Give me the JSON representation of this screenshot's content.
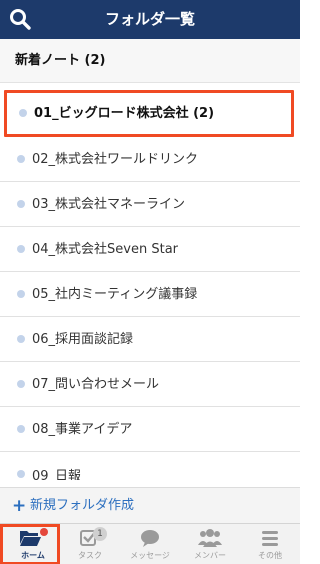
{
  "header": {
    "title": "フォルダ一覧",
    "search_icon": "search-icon"
  },
  "section": {
    "title": "新着ノート (2)"
  },
  "folders": [
    {
      "label": "01_ビッグロード株式会社 (2)",
      "selected": true
    },
    {
      "label": "02_株式会社ワールドリンク"
    },
    {
      "label": "03_株式会社マネーライン"
    },
    {
      "label": "04_株式会社Seven Star"
    },
    {
      "label": "05_社内ミーティング議事録"
    },
    {
      "label": "06_採用面談記録"
    },
    {
      "label": "07_問い合わせメール"
    },
    {
      "label": "08_事業アイデア"
    },
    {
      "label": "09_日報"
    }
  ],
  "new_folder": {
    "plus": "+",
    "label": "新規フォルダ作成"
  },
  "tabs": [
    {
      "label": "ホーム",
      "icon": "folder-open-icon",
      "active": true
    },
    {
      "label": "タスク",
      "icon": "check-icon",
      "badge": "1"
    },
    {
      "label": "メッセージ",
      "icon": "chat-icon"
    },
    {
      "label": "メンバー",
      "icon": "members-icon"
    },
    {
      "label": "その他",
      "icon": "menu-icon"
    }
  ],
  "colors": {
    "header_bg": "#1d3a6b",
    "accent_blue": "#2c6fbf",
    "highlight": "#f04a23",
    "dot": "#c3d3ea"
  }
}
